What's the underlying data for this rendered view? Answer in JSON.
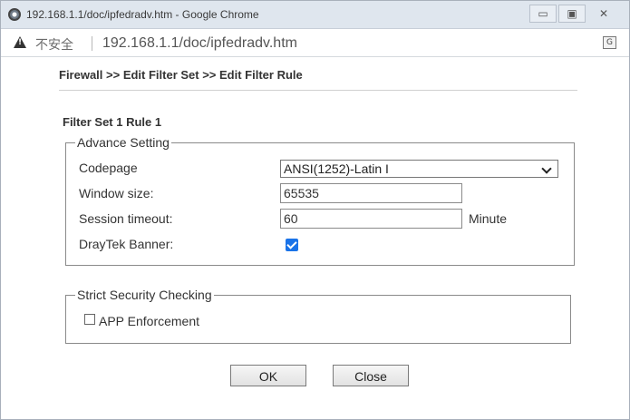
{
  "window": {
    "title": "192.168.1.1/doc/ipfedradv.htm - Google Chrome",
    "controls": {
      "minimize": "▭",
      "maximize": "▣",
      "close": "✕"
    }
  },
  "addressbar": {
    "security_label": "不安全",
    "url": "192.168.1.1/doc/ipfedradv.htm",
    "translate_icon_glyph": "G"
  },
  "page": {
    "breadcrumb": "Firewall >> Edit Filter Set >> Edit Filter Rule",
    "section_title": "Filter Set 1 Rule 1"
  },
  "advance_setting": {
    "legend": "Advance Setting",
    "codepage": {
      "label": "Codepage",
      "value": "ANSI(1252)-Latin I"
    },
    "window_size": {
      "label": "Window size:",
      "value": "65535"
    },
    "session_timeout": {
      "label": "Session timeout:",
      "value": "60",
      "unit": "Minute"
    },
    "draytek_banner": {
      "label": "DrayTek Banner:",
      "checked": true
    }
  },
  "strict_security": {
    "legend": "Strict Security Checking",
    "app_enforcement": {
      "label": "APP Enforcement",
      "checked": false
    }
  },
  "buttons": {
    "ok": "OK",
    "close": "Close"
  },
  "colors": {
    "accent": "#1a73e8",
    "titlebar": "#dfe6ee"
  }
}
